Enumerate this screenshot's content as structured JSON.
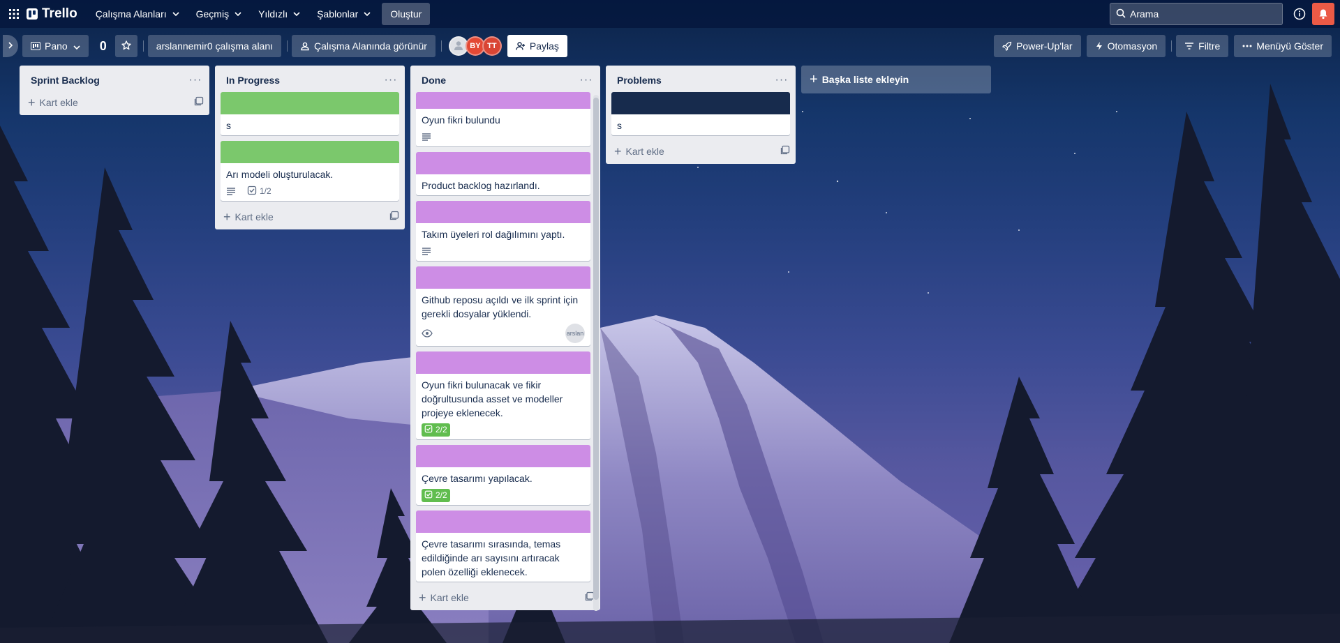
{
  "topnav": {
    "logo": "Trello",
    "menus": [
      "Çalışma Alanları",
      "Geçmiş",
      "Yıldızlı",
      "Şablonlar"
    ],
    "create": "Oluştur",
    "search_placeholder": "Arama"
  },
  "board_header": {
    "view": "Pano",
    "title": "0",
    "workspace": "arslannemir0 çalışma alanı",
    "visibility": "Çalışma Alanında görünür",
    "members": [
      {
        "initials": "",
        "color": "#dfe1e6"
      },
      {
        "initials": "BY",
        "color": "#e34935"
      },
      {
        "initials": "TT",
        "color": "#d94534"
      }
    ],
    "share": "Paylaş",
    "powerups": "Power-Up'lar",
    "automation": "Otomasyon",
    "filter": "Filtre",
    "show_menu": "Menüyü Göster"
  },
  "lists": [
    {
      "title": "Sprint Backlog",
      "add_card": "Kart ekle",
      "cards": []
    },
    {
      "title": "In Progress",
      "add_card": "Kart ekle",
      "cards": [
        {
          "cover": "#7bc86c",
          "title": "s",
          "description": false,
          "checklist": ""
        },
        {
          "cover": "#7bc86c",
          "title": "Arı modeli oluşturulacak.",
          "description": true,
          "checklist": "1/2"
        }
      ]
    },
    {
      "title": "Done",
      "add_card": "Kart ekle",
      "cards": [
        {
          "cover": "#cd8de5",
          "title": "Oyun fikri bulundu",
          "description": true,
          "checklist": ""
        },
        {
          "cover": "#cd8de5",
          "title": "Product backlog hazırlandı.",
          "description": false,
          "checklist": ""
        },
        {
          "cover": "#cd8de5",
          "title": "Takım üyeleri rol dağılımını yaptı.",
          "description": true,
          "checklist": ""
        },
        {
          "cover": "#cd8de5",
          "title": "Github reposu açıldı ve ilk sprint için gerekli dosyalar yüklendi.",
          "watch": true,
          "member": "arslan"
        },
        {
          "cover": "#cd8de5",
          "title": "Oyun fikri bulunacak ve fikir doğrultusunda asset ve modeller projeye eklenecek.",
          "checklist_complete": "2/2"
        },
        {
          "cover": "#cd8de5",
          "title": "Çevre tasarımı yapılacak.",
          "checklist_complete": "2/2"
        },
        {
          "cover": "#cd8de5",
          "title": "Çevre tasarımı sırasında, temas edildiğinde arı sayısını artıracak polen özelliği eklenecek."
        }
      ]
    },
    {
      "title": "Problems",
      "add_card": "Kart ekle",
      "cards": [
        {
          "cover": "#172b4d",
          "title": "s"
        }
      ]
    }
  ],
  "add_list": "Başka liste ekleyin"
}
